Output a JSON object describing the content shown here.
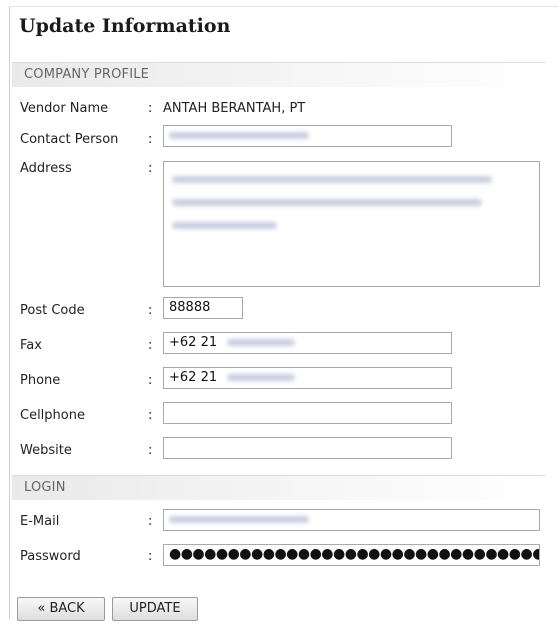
{
  "page": {
    "title": "Update Information"
  },
  "company_profile": {
    "heading": "COMPANY PROFILE",
    "vendor_name": {
      "label": "Vendor Name",
      "value": "ANTAH BERANTAH, PT"
    },
    "contact_person": {
      "label": "Contact Person",
      "value": ""
    },
    "address": {
      "label": "Address",
      "value": ""
    },
    "post_code": {
      "label": "Post Code",
      "value": "88888"
    },
    "fax": {
      "label": "Fax",
      "value": "+62 21"
    },
    "phone": {
      "label": "Phone",
      "value": "+62 21"
    },
    "cellphone": {
      "label": "Cellphone",
      "value": ""
    },
    "website": {
      "label": "Website",
      "value": ""
    }
  },
  "login": {
    "heading": "LOGIN",
    "email": {
      "label": "E-Mail",
      "value": ""
    },
    "password": {
      "label": "Password",
      "value": "●●●●●●●●●●●●●●●●●●●●●●●●●●●●●●●●"
    }
  },
  "colon": ":",
  "buttons": {
    "back": "« BACK",
    "update": "UPDATE"
  }
}
